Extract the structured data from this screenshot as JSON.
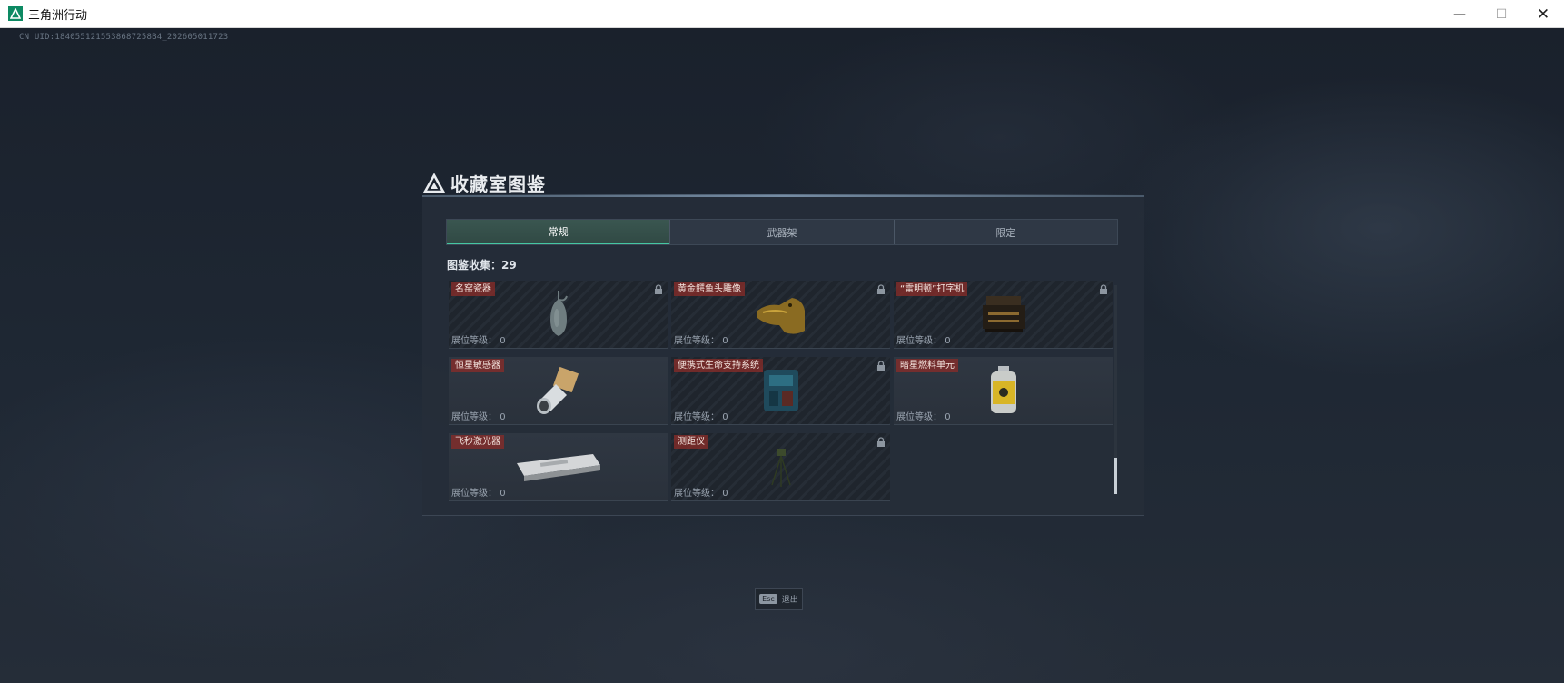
{
  "window": {
    "title": "三角洲行动",
    "minimize_glyph": "—",
    "maximize_glyph": "☐",
    "close_glyph": "✕"
  },
  "uid_text": "CN UID:1840551215538687258B4_202605011723",
  "panel": {
    "title": "收藏室图鉴",
    "collection_label": "图鉴收集：",
    "collection_count": "29",
    "tabs": [
      {
        "label": "常规",
        "active": true
      },
      {
        "label": "武器架",
        "active": false
      },
      {
        "label": "限定",
        "active": false
      }
    ],
    "items": [
      {
        "name": "名窑瓷器",
        "level_label": "展位等级：",
        "level": "0",
        "locked": true,
        "icon": "porcelain-vase-icon"
      },
      {
        "name": "黄金鳄鱼头雕像",
        "level_label": "展位等级：",
        "level": "0",
        "locked": true,
        "icon": "gold-crocodile-head-icon"
      },
      {
        "name": "“雷明顿”打字机",
        "level_label": "展位等级：",
        "level": "0",
        "locked": true,
        "icon": "typewriter-icon"
      },
      {
        "name": "恒星敏感器",
        "level_label": "展位等级：",
        "level": "0",
        "locked": false,
        "icon": "star-sensor-icon"
      },
      {
        "name": "便携式生命支持系统",
        "level_label": "展位等级：",
        "level": "0",
        "locked": true,
        "icon": "life-support-system-icon"
      },
      {
        "name": "暗星燃料单元",
        "level_label": "展位等级：",
        "level": "0",
        "locked": false,
        "icon": "fuel-cell-icon"
      },
      {
        "name": "飞秒激光器",
        "level_label": "展位等级：",
        "level": "0",
        "locked": false,
        "icon": "femtosecond-laser-icon"
      },
      {
        "name": "测距仪",
        "level_label": "展位等级：",
        "level": "0",
        "locked": true,
        "icon": "rangefinder-tripod-icon"
      }
    ]
  },
  "esc_hint": {
    "key": "Esc",
    "label": "退出"
  },
  "colors": {
    "accent": "#45c6a2",
    "label_bg": "#8c2c28",
    "brand": "#0d8a63"
  }
}
